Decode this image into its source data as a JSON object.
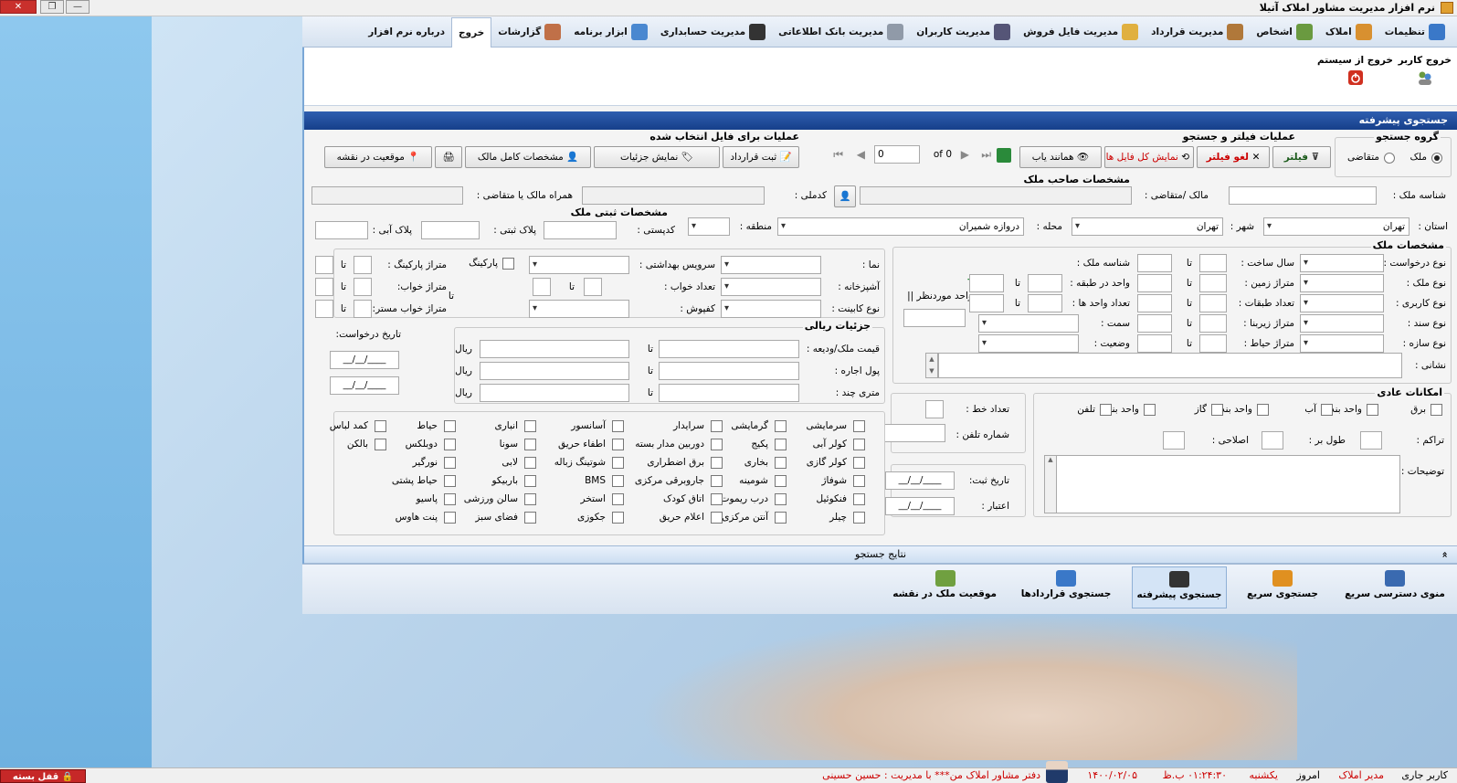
{
  "window": {
    "title": "نرم افزار مدیریت مشاور املاک آتیلا",
    "close": "✕",
    "restore": "❐",
    "minimize": "—"
  },
  "menu": [
    {
      "label": "تنظیمات",
      "color": "#3a78c8"
    },
    {
      "label": "املاک",
      "color": "#d89030"
    },
    {
      "label": "اشخاص",
      "color": "#6a9a40"
    },
    {
      "label": "مدیریت قرارداد",
      "color": "#b0783a"
    },
    {
      "label": "مدیریت فایل فروش",
      "color": "#e0b040"
    },
    {
      "label": "مدیریت کاربران",
      "color": "#555577"
    },
    {
      "label": "مدیریت بانک اطلاعاتی",
      "color": "#909aa8"
    },
    {
      "label": "مدیریت حسابداری",
      "color": "#333333"
    },
    {
      "label": "ابزار برنامه",
      "color": "#4a88d0"
    },
    {
      "label": "گزارشات",
      "color": "#c07048"
    },
    {
      "label": "خروج",
      "color": "",
      "active": true
    },
    {
      "label": "درباره نرم افزار",
      "color": ""
    }
  ],
  "ribbon": {
    "logout_user": "خروج کاربر",
    "exit_system": "خروج از سیستم"
  },
  "panel_title": "جستجوی پیشرفته",
  "search_group": {
    "title": "گروه جستجو",
    "opt1": "ملک",
    "opt2": "متقاضی"
  },
  "filter_ops": {
    "title": "عملیات فیلتر و جستجو",
    "filter": "فیلتر",
    "cancel_filter": "لغو فیلتر",
    "show_all": "نمایش کل فایل ها",
    "similar": "همانند یاب",
    "page_value": "0",
    "of_label": "of 0"
  },
  "file_ops": {
    "title": "عملیات برای فایل انتخاب شده",
    "contract": "ثبت قرارداد",
    "details": "نمایش جزئیات",
    "owner": "مشخصات کامل مالک",
    "map": "موقعیت در نقشه"
  },
  "owner": {
    "title": "مشخصات صاحب ملک",
    "property_id": "شناسه ملک :",
    "owner_label": "مالک /متقاضی :",
    "code_label": "کدملی :",
    "companion": "همراه مالک یا متقاضی :"
  },
  "location": {
    "province": "استان :",
    "province_val": "تهران",
    "city": "شهر :",
    "city_val": "تهران",
    "area": "محله :",
    "area_val": "دروازه شمیران",
    "region": "منطقه :"
  },
  "registry": {
    "title": "مشخصات ثبتی ملک",
    "kadastr": "کدپستی :",
    "reg_plate": "پلاک ثبتی :",
    "blue_plate": "پلاک آبی :"
  },
  "property": {
    "title": "مشخصات ملک",
    "request_type": "نوع درخواست :",
    "property_type": "نوع ملک :",
    "usage_type": "نوع کاربری :",
    "doc_type": "نوع سند :",
    "build_type": "نوع سازه :",
    "build_year": "سال ساخت :",
    "land_area": "متراژ زمین :",
    "floors": "تعداد طبقات :",
    "built_area": "متراژ زیربنا :",
    "yard_area": "متراژ حیاط :",
    "prop_id": "شناسه ملک :",
    "units_per_floor": "واحد در طبقه :",
    "units_count": "تعداد واحد ها :",
    "direction": "سمت :",
    "status": "وضعیت :",
    "target_unit": "واحد موردنظر ||",
    "address": "نشانی :",
    "to": "تا",
    "plus": "+"
  },
  "interior": {
    "facade": "نما :",
    "kitchen": "آشپزخانه :",
    "cabinet": "نوع کابینت :",
    "service": "سرویس بهداشتی :",
    "bedrooms": "تعداد خواب :",
    "flooring": "کفپوش :",
    "parking": "پارکینگ",
    "parking_area": "متراژ پارکینگ :",
    "bed_area": "متراژ خواب:",
    "master_area": "متراژ خواب مستر:",
    "to": "تا"
  },
  "price": {
    "title": "جزئیات ریالی",
    "total": "قیمت ملک/ودیعه :",
    "rent": "پول اجاره :",
    "per_meter": "متری چند :",
    "to": "تا",
    "rial": "ریال",
    "dot": "."
  },
  "dates": {
    "request_date": "تاریخ درخواست:",
    "date_mask": "__/__/____",
    "reg_date": "تاریخ ثبت:",
    "validity": "اعتبار :"
  },
  "phone": {
    "lines": "تعداد خط :",
    "phone": "شماره تلفن :"
  },
  "basic": {
    "title": "امکانات عادی",
    "items": [
      "برق",
      "واحد بندی",
      "آب",
      "واحد بندی",
      "گاز",
      "واحد بندی",
      "تلفن"
    ],
    "density": "تراکم :",
    "length": "طول بر :",
    "corrective": "اصلاحی :",
    "notes": "توضیحات :"
  },
  "amenities": [
    [
      "سرمایشی",
      "گرمایشی",
      "سرایدار",
      "آسانسور",
      "انباری",
      "حیاط",
      "کمد لباس"
    ],
    [
      "کولر آبی",
      "پکیج",
      "دوربین مدار بسته",
      "اطفاء حریق",
      "سونا",
      "دوبلکس",
      "بالکن"
    ],
    [
      "کولر گازی",
      "بخاری",
      "برق اضطراری",
      "شوتینگ زباله",
      "لابی",
      "نورگیر",
      ""
    ],
    [
      "شوفاژ",
      "شومینه",
      "جاروبرقی مرکزی",
      "BMS",
      "باربیکو",
      "حیاط پشتی",
      ""
    ],
    [
      "فنکوئیل",
      "درب ریموت",
      "اتاق کودک",
      "استخر",
      "سالن ورزشی",
      "پاسیو",
      ""
    ],
    [
      "چیلر",
      "آنتن مرکزی",
      "اعلام حریق",
      "جکوزی",
      "فضای سبز",
      "پنت هاوس",
      ""
    ]
  ],
  "results": {
    "label": "نتایج جستجو",
    "chevron": "»"
  },
  "bottom": [
    {
      "label": "منوی دسترسی سریع",
      "color": "#3a6ab0"
    },
    {
      "label": "جستجوی سریع",
      "color": "#e09020",
      "active": false
    },
    {
      "label": "جستجوی پیشرفته",
      "color": "#333333",
      "active": true
    },
    {
      "label": "جستجوی قراردادها",
      "color": "#3a78c8",
      "active": false
    },
    {
      "label": "موقعیت ملک در نقشه",
      "color": "#70a040",
      "active": false
    }
  ],
  "status": {
    "user_label": "کاربر جاری",
    "user_role": "مدیر املاک",
    "today": "امروز",
    "weekday": "یکشنبه",
    "time": "۰۱:۲۴:۳۰ ب.ظ",
    "date": "۱۴۰۰/۰۲/۰۵",
    "office": "دفتر مشاور املاک من*** با مدیریت : حسین حسینی",
    "lock": "قفل بسته است"
  }
}
